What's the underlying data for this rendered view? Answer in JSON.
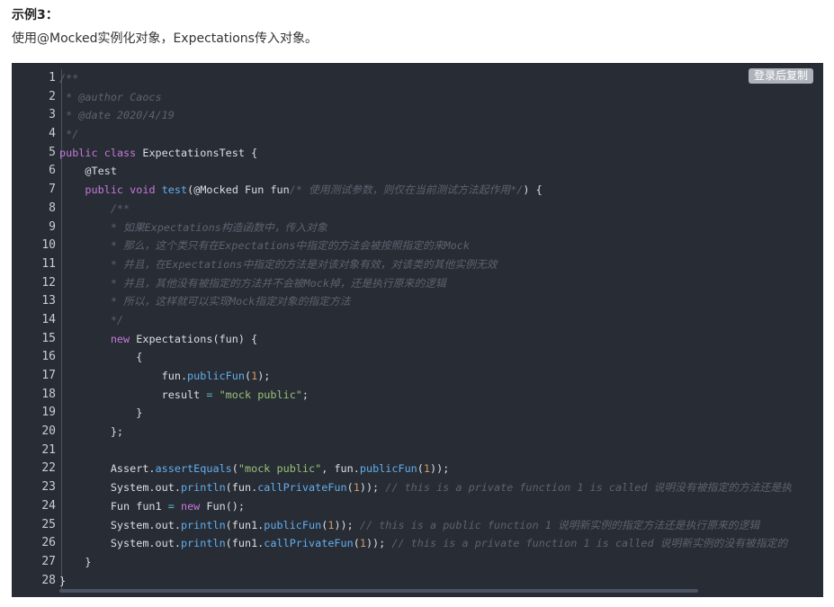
{
  "article": {
    "heading": "示例3：",
    "description": "使用@Mocked实例化对象，Expectations传入对象。"
  },
  "code_block": {
    "copy_label": "登录后复制",
    "line_numbers": [
      "1",
      "2",
      "3",
      "4",
      "5",
      "6",
      "7",
      "8",
      "9",
      "10",
      "11",
      "12",
      "13",
      "14",
      "15",
      "16",
      "17",
      "18",
      "19",
      "20",
      "21",
      "22",
      "23",
      "24",
      "25",
      "26",
      "27",
      "28"
    ],
    "lines": [
      [
        {
          "t": "/**",
          "c": "comment"
        }
      ],
      [
        {
          "t": " * @author Caocs",
          "c": "comment"
        }
      ],
      [
        {
          "t": " * @date 2020/4/19",
          "c": "comment"
        }
      ],
      [
        {
          "t": " */",
          "c": "comment"
        }
      ],
      [
        {
          "t": "public",
          "c": "keyword"
        },
        {
          "t": " "
        },
        {
          "t": "class",
          "c": "keyword"
        },
        {
          "t": " ExpectationsTest {"
        }
      ],
      [
        {
          "t": "    @Test"
        }
      ],
      [
        {
          "t": "    "
        },
        {
          "t": "public",
          "c": "keyword"
        },
        {
          "t": " "
        },
        {
          "t": "void",
          "c": "keyword"
        },
        {
          "t": " "
        },
        {
          "t": "test",
          "c": "func"
        },
        {
          "t": "(@Mocked Fun fun"
        },
        {
          "t": "/* 使用测试参数，则仅在当前测试方法起作用*/",
          "c": "comment"
        },
        {
          "t": ") {"
        }
      ],
      [
        {
          "t": "        /**",
          "c": "comment"
        }
      ],
      [
        {
          "t": "        * 如果Expectations构造函数中，传入对象",
          "c": "comment"
        }
      ],
      [
        {
          "t": "        * 那么，这个类只有在Expectations中指定的方法会被按照指定的来Mock",
          "c": "comment"
        }
      ],
      [
        {
          "t": "        * 并且，在Expectations中指定的方法是对该对象有效，对该类的其他实例无效",
          "c": "comment"
        }
      ],
      [
        {
          "t": "        * 并且，其他没有被指定的方法并不会被Mock掉，还是执行原来的逻辑",
          "c": "comment"
        }
      ],
      [
        {
          "t": "        * 所以，这样就可以实现Mock指定对象的指定方法",
          "c": "comment"
        }
      ],
      [
        {
          "t": "        */",
          "c": "comment"
        }
      ],
      [
        {
          "t": "        "
        },
        {
          "t": "new",
          "c": "keyword"
        },
        {
          "t": " Expectations(fun) {"
        }
      ],
      [
        {
          "t": "            {"
        }
      ],
      [
        {
          "t": "                fun."
        },
        {
          "t": "publicFun",
          "c": "func"
        },
        {
          "t": "("
        },
        {
          "t": "1",
          "c": "number"
        },
        {
          "t": ");"
        }
      ],
      [
        {
          "t": "                result "
        },
        {
          "t": "=",
          "c": "op"
        },
        {
          "t": " "
        },
        {
          "t": "\"mock public\"",
          "c": "string"
        },
        {
          "t": ";"
        }
      ],
      [
        {
          "t": "            }"
        }
      ],
      [
        {
          "t": "        };"
        }
      ],
      [
        {
          "t": ""
        }
      ],
      [
        {
          "t": "        Assert."
        },
        {
          "t": "assertEquals",
          "c": "func"
        },
        {
          "t": "("
        },
        {
          "t": "\"mock public\"",
          "c": "string"
        },
        {
          "t": ", fun."
        },
        {
          "t": "publicFun",
          "c": "func"
        },
        {
          "t": "("
        },
        {
          "t": "1",
          "c": "number"
        },
        {
          "t": "));"
        }
      ],
      [
        {
          "t": "        System.out."
        },
        {
          "t": "println",
          "c": "func"
        },
        {
          "t": "(fun."
        },
        {
          "t": "callPrivateFun",
          "c": "func"
        },
        {
          "t": "("
        },
        {
          "t": "1",
          "c": "number"
        },
        {
          "t": ")); "
        },
        {
          "t": "// this is a private function 1 is called 说明没有被指定的方法还是执",
          "c": "comment"
        }
      ],
      [
        {
          "t": "        Fun fun1 "
        },
        {
          "t": "=",
          "c": "op"
        },
        {
          "t": " "
        },
        {
          "t": "new",
          "c": "keyword"
        },
        {
          "t": " Fun();"
        }
      ],
      [
        {
          "t": "        System.out."
        },
        {
          "t": "println",
          "c": "func"
        },
        {
          "t": "(fun1."
        },
        {
          "t": "publicFun",
          "c": "func"
        },
        {
          "t": "("
        },
        {
          "t": "1",
          "c": "number"
        },
        {
          "t": ")); "
        },
        {
          "t": "// this is a public function 1 说明新实例的指定方法还是执行原来的逻辑",
          "c": "comment"
        }
      ],
      [
        {
          "t": "        System.out."
        },
        {
          "t": "println",
          "c": "func"
        },
        {
          "t": "(fun1."
        },
        {
          "t": "callPrivateFun",
          "c": "func"
        },
        {
          "t": "("
        },
        {
          "t": "1",
          "c": "number"
        },
        {
          "t": ")); "
        },
        {
          "t": "// this is a private function 1 is called 说明新实例的没有被指定的",
          "c": "comment"
        }
      ],
      [
        {
          "t": "    }"
        }
      ],
      [
        {
          "t": "}"
        }
      ]
    ]
  },
  "colors": {
    "code_background": "#282c34",
    "comment": "#5c6370",
    "keyword": "#c678dd",
    "function": "#61afef",
    "number": "#d19a66",
    "string": "#98c379"
  }
}
